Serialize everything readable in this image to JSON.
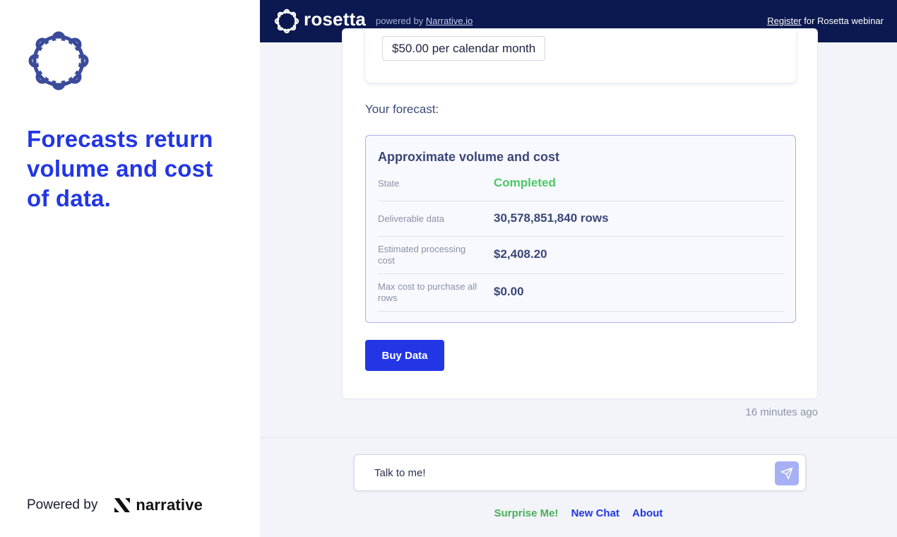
{
  "left": {
    "tagline": "Forecasts return volume and cost of data.",
    "powered_by": "Powered by",
    "brand_word": "narrative"
  },
  "header": {
    "brand": "rosetta",
    "powered_prefix": "powered by",
    "powered_link": "Narrative.io",
    "register_link": "Register",
    "register_suffix": "for Rosetta webinar"
  },
  "chat": {
    "prev_chip": "$50.00 per calendar month",
    "forecast_label": "Your forecast:",
    "forecast": {
      "title": "Approximate volume and cost",
      "rows": [
        {
          "key": "State",
          "value": "Completed"
        },
        {
          "key": "Deliverable data",
          "value": "30,578,851,840 rows"
        },
        {
          "key": "Estimated processing cost",
          "value": "$2,408.20"
        },
        {
          "key": "Max cost to purchase all rows",
          "value": "$0.00"
        }
      ]
    },
    "buy_button": "Buy Data",
    "timestamp": "16 minutes ago"
  },
  "composer": {
    "placeholder": "Talk to me!"
  },
  "footer_links": {
    "surprise": "Surprise Me!",
    "new_chat": "New Chat",
    "about": "About"
  },
  "colors": {
    "accent": "#2236e6",
    "navbar": "#0c1950",
    "success": "#4cc766"
  }
}
